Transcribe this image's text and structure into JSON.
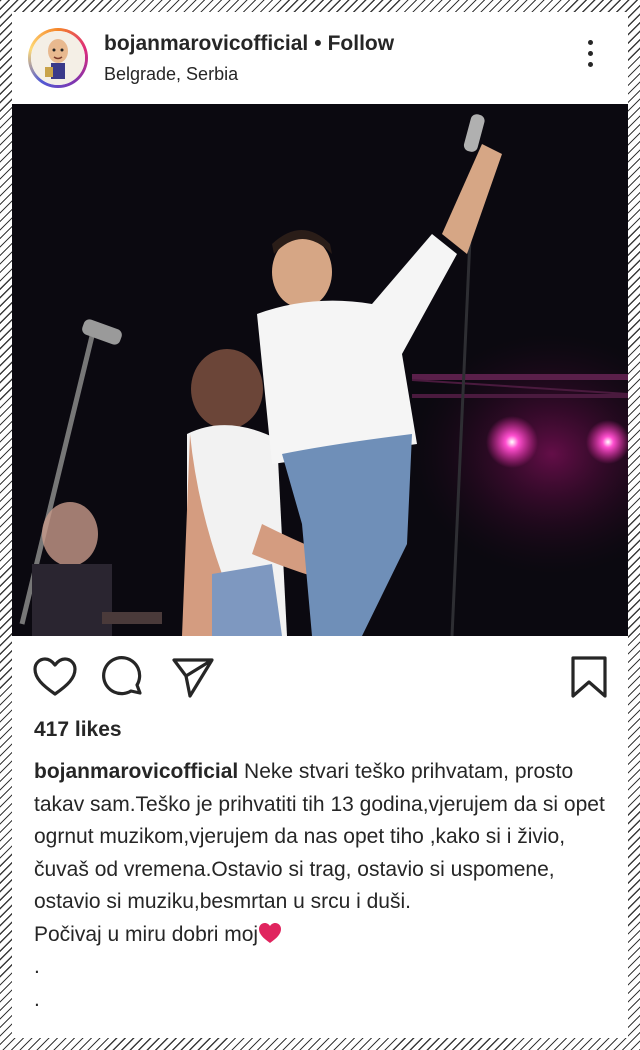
{
  "post": {
    "username": "bojanmarovicofficial",
    "separator": "•",
    "follow_label": "Follow",
    "location": "Belgrade, Serbia",
    "likes": "417 likes",
    "caption_user": "bojanmarovicofficial",
    "caption_text": " Neke stvari teško prihvatam, prosto takav sam.Teško je prihvatiti tih 13 godina,vjerujem da si opet ogrnut muzikom,vjerujem da nas opet tiho ,kako si i živio, čuvaš od vremena.Ostavio si trag, ostavio si uspomene, ostavio si muziku,besmrtan u srcu i duši.\nPočivaj u miru dobri moj",
    "caption_tail": "\n.\n."
  },
  "icons": {
    "avatar": "avatar-caricature",
    "more": "more-vertical-icon",
    "like": "heart-icon",
    "comment": "comment-bubble-icon",
    "share": "paper-plane-icon",
    "save": "bookmark-icon",
    "emoji": "red-heart-emoji"
  },
  "colors": {
    "text": "#262626",
    "heart_emoji": "#e0245e",
    "stage_light": "#ff2fb5",
    "background": "#ffffff"
  }
}
